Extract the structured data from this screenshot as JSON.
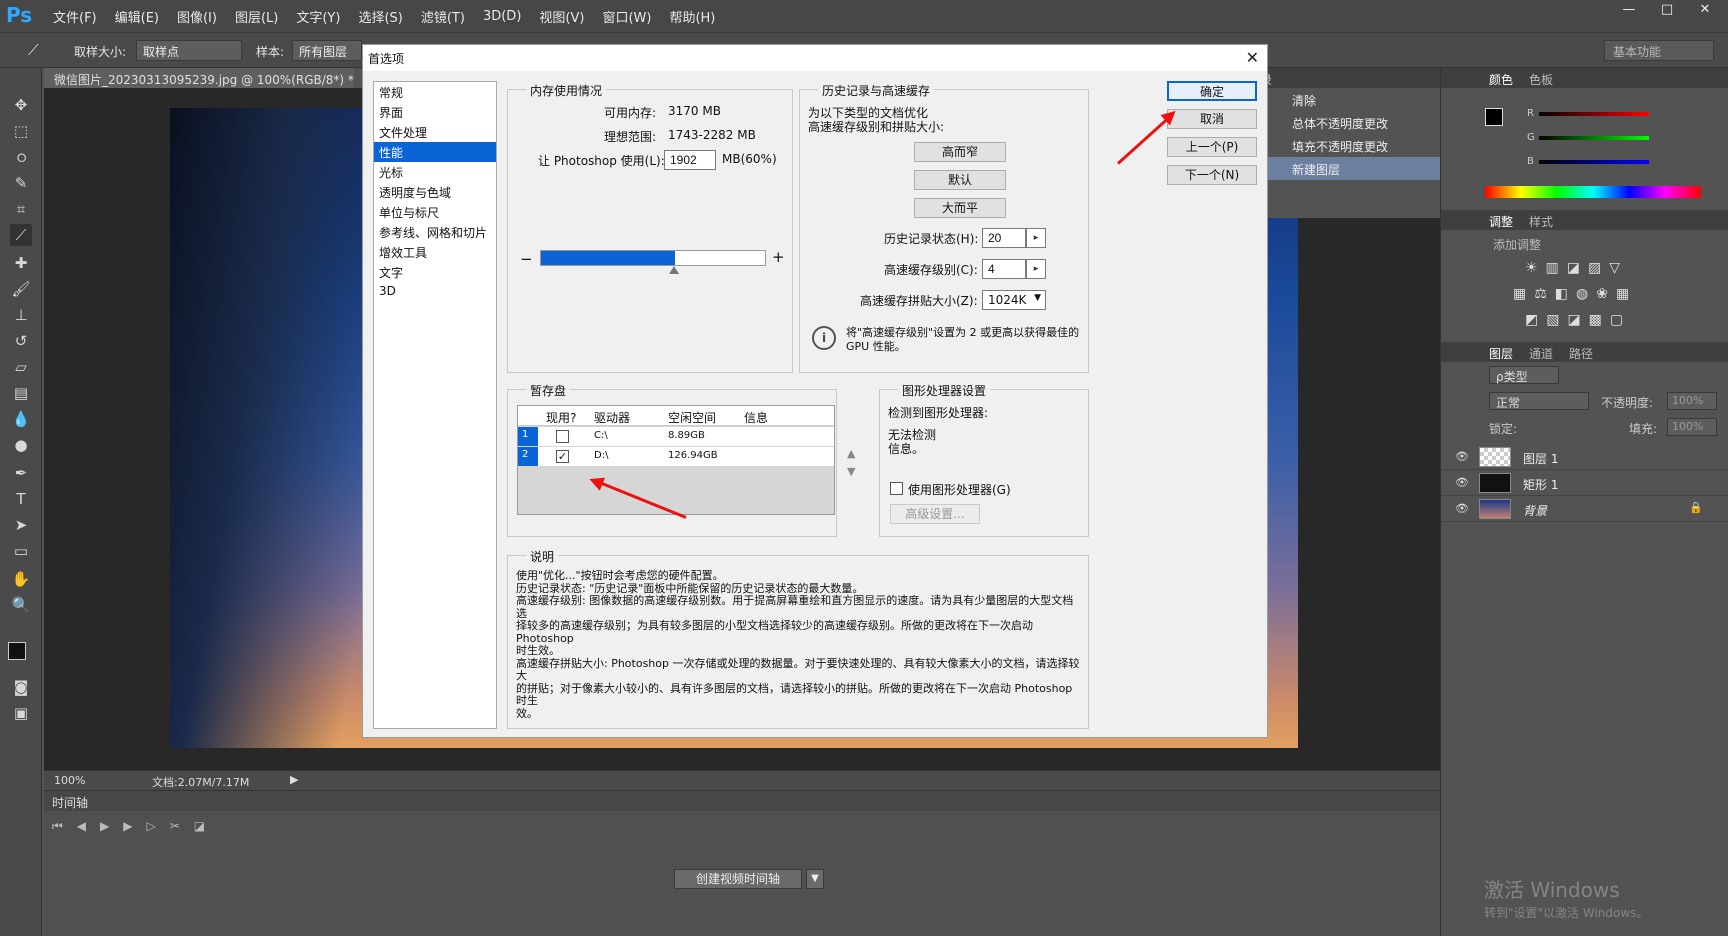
{
  "app": {
    "logo": "Ps",
    "menus": [
      "文件(F)",
      "编辑(E)",
      "图像(I)",
      "图层(L)",
      "文字(Y)",
      "选择(S)",
      "滤镜(T)",
      "3D(D)",
      "视图(V)",
      "窗口(W)",
      "帮助(H)"
    ],
    "window_controls": [
      "—",
      "□",
      "✕"
    ]
  },
  "options_bar": {
    "sample_size_label": "取样大小:",
    "sample_size_value": "取样点",
    "sample_label": "样本:",
    "sample_value": "所有图层",
    "workspace": "基本功能"
  },
  "document": {
    "tab_title": "微信图片_20230313095239.jpg @ 100%(RGB/8*) *",
    "tab_close": "×",
    "zoom": "100%",
    "doc_size": "文档:2.07M/7.17M"
  },
  "timeline": {
    "title": "时间轴",
    "create_button": "创建视频时间轴"
  },
  "history_panel": {
    "title": "记录",
    "items": [
      "清除",
      "总体不透明度更改",
      "填充不透明度更改",
      "新建图层"
    ]
  },
  "color_panel": {
    "tabs": [
      "颜色",
      "色板"
    ],
    "channels": [
      "R",
      "G",
      "B"
    ]
  },
  "adjust_panel": {
    "tabs": [
      "调整",
      "样式"
    ],
    "subtitle": "添加调整"
  },
  "layers_panel": {
    "tabs": [
      "图层",
      "通道",
      "路径"
    ],
    "filter": "ρ类型",
    "blend_mode": "正常",
    "opacity_label": "不透明度:",
    "opacity_value": "100%",
    "lock_label": "锁定:",
    "fill_label": "填充:",
    "fill_value": "100%",
    "layers": [
      "图层 1",
      "矩形 1",
      "背景"
    ]
  },
  "dialog": {
    "title": "首选项",
    "close": "✕",
    "nav": [
      "常规",
      "界面",
      "文件处理",
      "性能",
      "光标",
      "透明度与色域",
      "单位与标尺",
      "参考线、网格和切片",
      "增效工具",
      "文字",
      "3D"
    ],
    "nav_selected_index": 3,
    "memory": {
      "title": "内存使用情况",
      "available_label": "可用内存:",
      "available_value": "3170 MB",
      "ideal_label": "理想范围:",
      "ideal_value": "1743-2282 MB",
      "use_label": "让 Photoshop 使用(L):",
      "use_value": "1902",
      "use_unit": "MB(60%)",
      "slider_fraction": 0.6,
      "minus": "−",
      "plus": "+"
    },
    "history": {
      "title": "历史记录与高速缓存",
      "optimize_text_1": "为以下类型的文档优化",
      "optimize_text_2": "高速缓存级别和拼贴大小:",
      "btn_tall_thin": "高而窄",
      "btn_default": "默认",
      "btn_big_flat": "大而平",
      "states_label": "历史记录状态(H):",
      "states_value": "20",
      "cache_levels_label": "高速缓存级别(C):",
      "cache_levels_value": "4",
      "tile_size_label": "高速缓存拼贴大小(Z):",
      "tile_size_value": "1024K",
      "info_text_1": "将\"高速缓存级别\"设置为 2 或更高以获得最佳的",
      "info_text_2": "GPU 性能。"
    },
    "buttons": {
      "ok": "确定",
      "cancel": "取消",
      "prev": "上一个(P)",
      "next": "下一个(N)"
    },
    "scratch": {
      "title": "暂存盘",
      "headers": [
        "现用?",
        "驱动器",
        "空闲空间",
        "信息"
      ],
      "rows": [
        {
          "index": "1",
          "active": "",
          "drive": "C:\\",
          "free": "8.89GB"
        },
        {
          "index": "2",
          "active": "✓",
          "drive": "D:\\",
          "free": "126.94GB"
        }
      ]
    },
    "gpu": {
      "title": "图形处理器设置",
      "detected_label": "检测到图形处理器:",
      "undetect_1": "无法检测",
      "undetect_2": "信息。",
      "use_gpu_label": "使用图形处理器(G)",
      "advanced": "高级设置..."
    },
    "description": {
      "title": "说明",
      "lines": [
        "使用\"优化...\"按钮时会考虑您的硬件配置。",
        "历史记录状态: \"历史记录\"面板中所能保留的历史记录状态的最大数量。",
        "高速缓存级别: 图像数据的高速缓存级别数。用于提高屏幕重绘和直方图显示的速度。请为具有少量图层的大型文档选",
        "择较多的高速缓存级别；为具有较多图层的小型文档选择较少的高速缓存级别。所做的更改将在下一次启动 Photoshop",
        "时生效。",
        "高速缓存拼贴大小: Photoshop 一次存储或处理的数据量。对于要快速处理的、具有较大像素大小的文档，请选择较大",
        "的拼贴；对于像素大小较小的、具有许多图层的文档，请选择较小的拼贴。所做的更改将在下一次启动 Photoshop 时生",
        "效。"
      ]
    }
  },
  "watermark": {
    "line1": "激活 Windows",
    "line2": "转到\"设置\"以激活 Windows。"
  }
}
